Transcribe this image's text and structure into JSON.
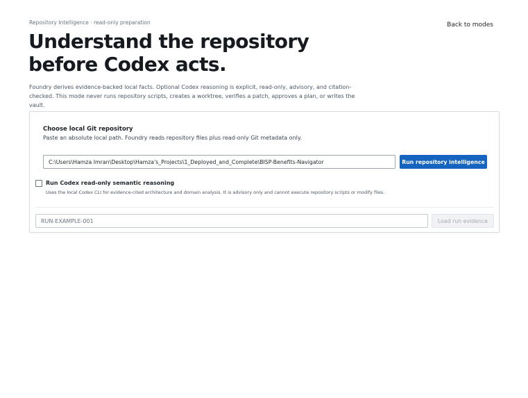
{
  "header": {
    "eyebrow": "Repository Intelligence · read-only preparation",
    "back_label": "Back to modes",
    "title": "Understand the repository before Codex acts.",
    "description": "Foundry derives evidence-backed local facts. Optional Codex reasoning is explicit, read-only, advisory, and citation-checked. This mode never runs repository scripts, creates a worktree, verifies a patch, approves a plan, or writes the vault."
  },
  "repo_section": {
    "label": "Choose local Git repository",
    "help": "Paste an absolute local path. Foundry reads repository files plus read-only Git metadata only.",
    "path_value": "C:\\Users\\Hamza Imran\\Desktop\\Hamza's_Projects\\1_Deployed_and_Complete\\BISP-Benefits-Navigator",
    "run_button_label": "Run repository intelligence"
  },
  "semantic_option": {
    "checked": false,
    "label": "Run Codex read-only semantic reasoning",
    "help": "Uses the local Codex CLI for evidence-cited architecture and domain analysis. It is advisory only and cannot execute repository scripts or modify files."
  },
  "run_evidence": {
    "placeholder": "RUN-EXAMPLE-001",
    "load_button_label": "Load run evidence"
  }
}
